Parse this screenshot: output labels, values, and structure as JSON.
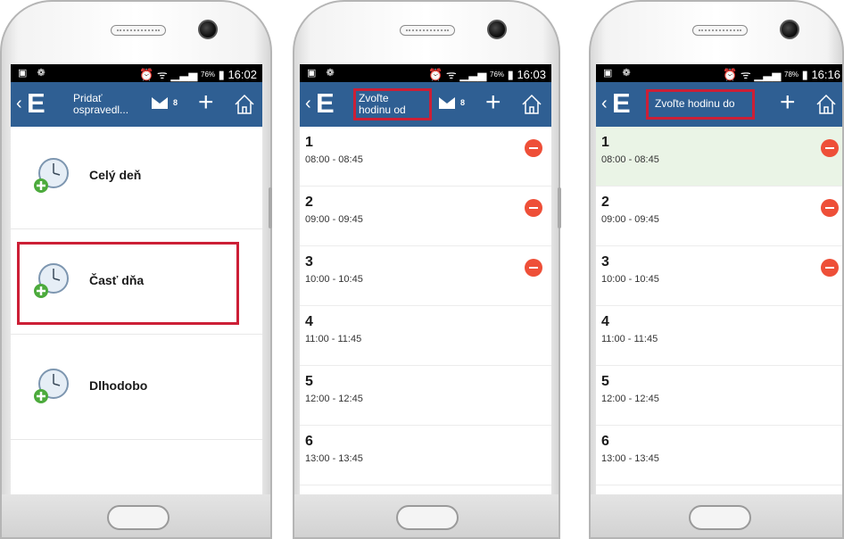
{
  "phone1": {
    "status": {
      "left_icons": "▣ ❁",
      "battery": "76%",
      "time": "16:02"
    },
    "appbar": {
      "title_line1": "Pridať",
      "title_line2": "ospravedl...",
      "mail_count": "8"
    },
    "options": [
      {
        "label": "Celý deň"
      },
      {
        "label": "Časť dňa"
      },
      {
        "label": "Dlhodobo"
      }
    ]
  },
  "phone2": {
    "status": {
      "left_icons": "▣ ❁",
      "battery": "76%",
      "time": "16:03"
    },
    "appbar": {
      "title_line1": "Zvoľte",
      "title_line2": "hodinu od",
      "mail_count": "8"
    },
    "lessons": [
      {
        "number": "1",
        "time": "08:00 - 08:45"
      },
      {
        "number": "2",
        "time": "09:00 - 09:45"
      },
      {
        "number": "3",
        "time": "10:00 - 10:45"
      },
      {
        "number": "4",
        "time": "11:00 - 11:45"
      },
      {
        "number": "5",
        "time": "12:00 - 12:45"
      },
      {
        "number": "6",
        "time": "13:00 - 13:45"
      }
    ]
  },
  "phone3": {
    "status": {
      "left_icons": "▣ ❁",
      "battery": "78%",
      "time": "16:16"
    },
    "appbar": {
      "title": "Zvoľte hodinu do"
    },
    "lessons": [
      {
        "number": "1",
        "time": "08:00 - 08:45"
      },
      {
        "number": "2",
        "time": "09:00 - 09:45"
      },
      {
        "number": "3",
        "time": "10:00 - 10:45"
      },
      {
        "number": "4",
        "time": "11:00 - 11:45"
      },
      {
        "number": "5",
        "time": "12:00 - 12:45"
      },
      {
        "number": "6",
        "time": "13:00 - 13:45"
      }
    ]
  },
  "colors": {
    "appbar": "#2f5f93",
    "highlight": "#cc1f36",
    "remove": "#ee4f38",
    "selected_row": "#eaf4e6"
  }
}
